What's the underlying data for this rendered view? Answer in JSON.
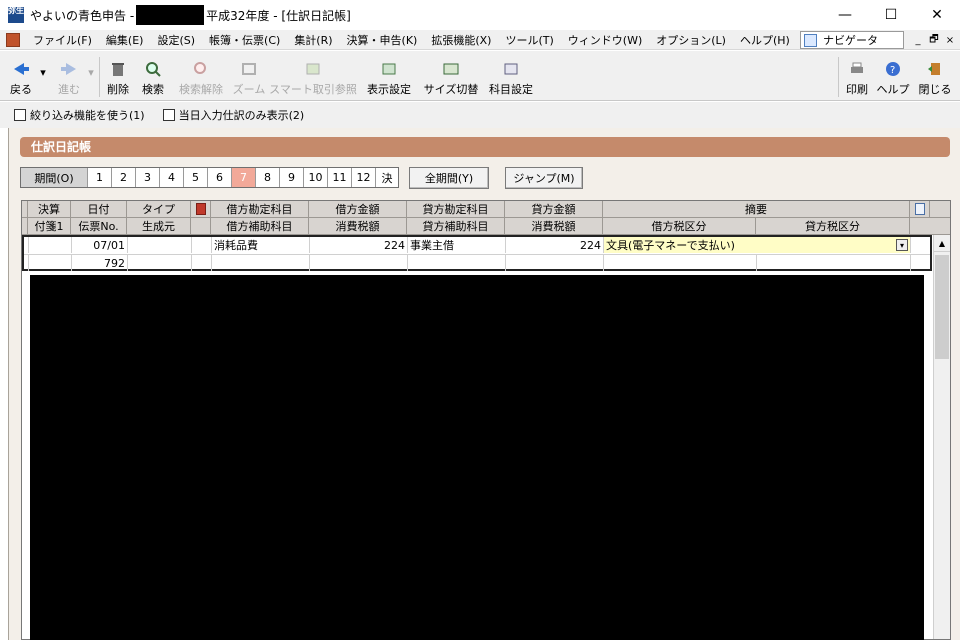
{
  "window": {
    "app_title_prefix": "やよいの青色申告 -",
    "app_title_suffix": "平成32年度 - [仕訳日記帳]",
    "icon_text": "弥生",
    "minimize": "—",
    "maximize": "☐",
    "close": "✕"
  },
  "menu": {
    "items": [
      "ファイル(F)",
      "編集(E)",
      "設定(S)",
      "帳簿・伝票(C)",
      "集計(R)",
      "決算・申告(K)",
      "拡張機能(X)",
      "ツール(T)",
      "ウィンドウ(W)",
      "オプション(L)",
      "ヘルプ(H)"
    ],
    "navigator_label": "ナビゲータ",
    "mdi_minimize": "_",
    "mdi_restore": "🗗",
    "mdi_close": "×"
  },
  "toolbar": {
    "back": "戻る",
    "forward": "進む",
    "delete": "削除",
    "search": "検索",
    "clear_search": "検索解除",
    "zoom": "ズーム",
    "smart_reference": "スマート取引参照",
    "display_settings": "表示設定",
    "size_switch": "サイズ切替",
    "account_settings": "科目設定",
    "print": "印刷",
    "help": "ヘルプ",
    "close": "閉じる"
  },
  "filters": {
    "use_filter": "絞り込み機能を使う(1)",
    "today_only": "当日入力仕訳のみ表示(2)"
  },
  "section_title": "仕訳日記帳",
  "periods": {
    "label": "期間(O)",
    "months": [
      "1",
      "2",
      "3",
      "4",
      "5",
      "6",
      "7",
      "8",
      "9",
      "10",
      "11",
      "12"
    ],
    "selected": "7",
    "closing": "決",
    "all_period_button": "全期間(Y)",
    "jump_button": "ジャンプ(M)"
  },
  "grid": {
    "header_row1": [
      "決算",
      "日付",
      "タイプ",
      "借方勘定科目",
      "借方金額",
      "貸方勘定科目",
      "貸方金額",
      "摘要"
    ],
    "header_row2": [
      "付箋1",
      "伝票No.",
      "生成元",
      "借方補助科目",
      "消費税額",
      "貸方補助科目",
      "消費税額",
      "借方税区分",
      "貸方税区分"
    ],
    "rows": [
      {
        "date": "07/01",
        "voucher_no": "792",
        "debit_account": "消耗品費",
        "debit_amount": "224",
        "credit_account": "事業主借",
        "credit_amount": "224",
        "description": "文具(電子マネーで支払い)"
      }
    ]
  },
  "colors": {
    "section_header": "#c58a6b",
    "selected_month": "#f2a999",
    "description_highlight": "#fffdc6"
  }
}
